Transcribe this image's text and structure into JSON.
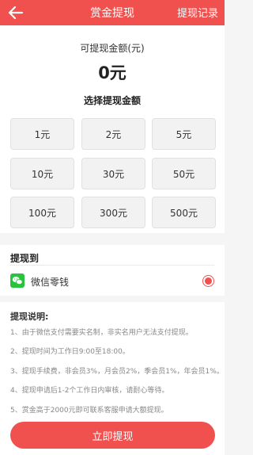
{
  "header": {
    "title": "赏金提现",
    "record_link": "提现记录"
  },
  "amount": {
    "label": "可提现金额(元)",
    "value": "0元",
    "choose_title": "选择提现金额",
    "options": [
      "1元",
      "2元",
      "5元",
      "10元",
      "30元",
      "50元",
      "100元",
      "300元",
      "500元"
    ]
  },
  "method": {
    "title": "提现到",
    "name": "微信零钱",
    "icon": "wechat-icon",
    "selected": true
  },
  "notes": {
    "title": "提现说明:",
    "items": [
      "1、由于微信支付需要实名制，非实名用户无法支付提现。",
      "2、提现时间为工作日9:00至18:00。",
      "3、提现手续费，非会员3%，月会员2%，季会员1%，年会员1%。",
      "4、提现申请后1-2个工作日内审核，请耐心等待。",
      "5、赏金高于2000元即可联系客服申请大额提现。"
    ]
  },
  "submit_label": "立即提现",
  "colors": {
    "accent": "#f0514f",
    "wechat": "#2ac33e"
  }
}
